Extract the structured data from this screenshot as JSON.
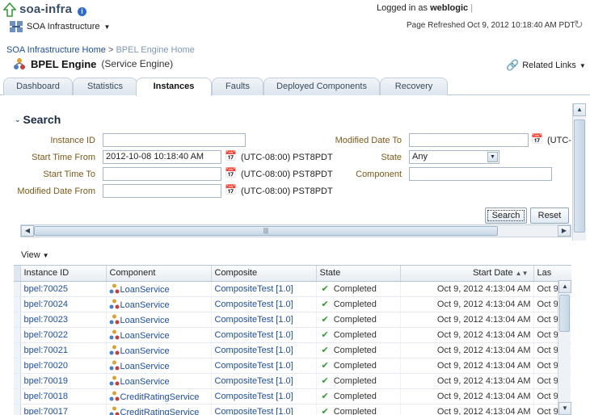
{
  "header": {
    "app_title": "soa-infra",
    "menu_label": "SOA Infrastructure",
    "logged_in_prefix": "Logged in as",
    "user": "weblogic",
    "page_refreshed": "Page Refreshed Oct 9, 2012 10:18:40 AM PDT"
  },
  "breadcrumb": {
    "link": "SOA Infrastructure Home",
    "sep": ">",
    "current": "BPEL Engine Home"
  },
  "page": {
    "title": "BPEL Engine",
    "subtitle": "(Service Engine)",
    "related_links": "Related Links"
  },
  "tabs": [
    {
      "label": "Dashboard"
    },
    {
      "label": "Statistics"
    },
    {
      "label": "Instances"
    },
    {
      "label": "Faults"
    },
    {
      "label": "Deployed Components"
    },
    {
      "label": "Recovery"
    }
  ],
  "search": {
    "heading": "Search",
    "instance_id_label": "Instance ID",
    "instance_id_value": "",
    "start_from_label": "Start Time From",
    "start_from_value": "2012-10-08 10:18:40 AM",
    "start_to_label": "Start Time To",
    "start_to_value": "",
    "modified_from_label": "Modified Date From",
    "modified_from_value": "",
    "modified_to_label": "Modified Date To",
    "modified_to_value": "",
    "state_label": "State",
    "state_value": "Any",
    "component_label": "Component",
    "component_value": "",
    "tz": "(UTC-08:00) PST8PDT",
    "tz_cut": "(UTC-",
    "search_button": "Search",
    "reset_button": "Reset"
  },
  "table": {
    "view_menu": "View",
    "columns": [
      "Instance ID",
      "Component",
      "Composite",
      "State",
      "Start Date",
      "Las"
    ],
    "rows": [
      {
        "id": "bpel:70025",
        "component": "LoanService",
        "composite": "CompositeTest [1.0]",
        "state": "Completed",
        "start": "Oct 9, 2012 4:13:04 AM",
        "last": "Oct 9"
      },
      {
        "id": "bpel:70024",
        "component": "LoanService",
        "composite": "CompositeTest [1.0]",
        "state": "Completed",
        "start": "Oct 9, 2012 4:13:04 AM",
        "last": "Oct 9"
      },
      {
        "id": "bpel:70023",
        "component": "LoanService",
        "composite": "CompositeTest [1.0]",
        "state": "Completed",
        "start": "Oct 9, 2012 4:13:04 AM",
        "last": "Oct 9"
      },
      {
        "id": "bpel:70022",
        "component": "LoanService",
        "composite": "CompositeTest [1.0]",
        "state": "Completed",
        "start": "Oct 9, 2012 4:13:04 AM",
        "last": "Oct 9"
      },
      {
        "id": "bpel:70021",
        "component": "LoanService",
        "composite": "CompositeTest [1.0]",
        "state": "Completed",
        "start": "Oct 9, 2012 4:13:04 AM",
        "last": "Oct 9"
      },
      {
        "id": "bpel:70020",
        "component": "LoanService",
        "composite": "CompositeTest [1.0]",
        "state": "Completed",
        "start": "Oct 9, 2012 4:13:04 AM",
        "last": "Oct 9"
      },
      {
        "id": "bpel:70019",
        "component": "LoanService",
        "composite": "CompositeTest [1.0]",
        "state": "Completed",
        "start": "Oct 9, 2012 4:13:04 AM",
        "last": "Oct 9"
      },
      {
        "id": "bpel:70018",
        "component": "CreditRatingService",
        "composite": "CompositeTest [1.0]",
        "state": "Completed",
        "start": "Oct 9, 2012 4:13:04 AM",
        "last": "Oct 9"
      },
      {
        "id": "bpel:70017",
        "component": "CreditRatingService",
        "composite": "CompositeTest [1.0]",
        "state": "Completed",
        "start": "Oct 9, 2012 4:13:04 AM",
        "last": "Oct 9"
      }
    ]
  },
  "colors": {
    "link": "#1f4fa0",
    "label": "#7a5a1a",
    "check": "#2e9a2e"
  }
}
